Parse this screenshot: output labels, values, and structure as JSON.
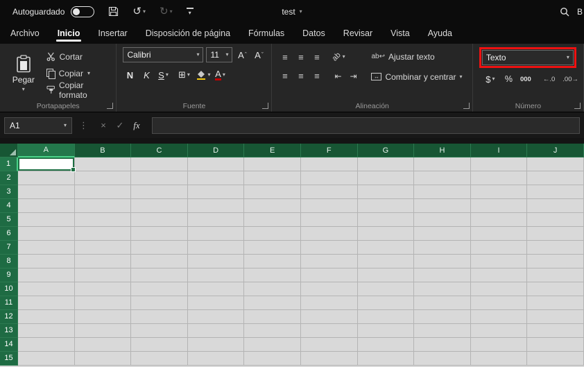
{
  "titlebar": {
    "autosave_label": "Autoguardado",
    "document_title": "test",
    "search_text": "B"
  },
  "tabs": [
    {
      "label": "Archivo",
      "active": false
    },
    {
      "label": "Inicio",
      "active": true
    },
    {
      "label": "Insertar",
      "active": false
    },
    {
      "label": "Disposición de página",
      "active": false
    },
    {
      "label": "Fórmulas",
      "active": false
    },
    {
      "label": "Datos",
      "active": false
    },
    {
      "label": "Revisar",
      "active": false
    },
    {
      "label": "Vista",
      "active": false
    },
    {
      "label": "Ayuda",
      "active": false
    }
  ],
  "ribbon": {
    "clipboard": {
      "group_label": "Portapapeles",
      "paste_label": "Pegar",
      "cut_label": "Cortar",
      "copy_label": "Copiar",
      "format_painter_label": "Copiar formato"
    },
    "font": {
      "group_label": "Fuente",
      "font_name": "Calibri",
      "font_size": "11",
      "bold_label": "N",
      "italic_label": "K",
      "underline_label": "S"
    },
    "alignment": {
      "group_label": "Alineación",
      "wrap_text_label": "Ajustar texto",
      "merge_center_label": "Combinar y centrar"
    },
    "number": {
      "group_label": "Número",
      "format_value": "Texto",
      "currency_label": "$",
      "percent_label": "%",
      "thousands_label": "000",
      "highlight_color": "#ee1111"
    }
  },
  "formula_bar": {
    "name_box_value": "A1",
    "fx_label": "fx",
    "formula_value": ""
  },
  "grid": {
    "columns": [
      "A",
      "B",
      "C",
      "D",
      "E",
      "F",
      "G",
      "H",
      "I",
      "J"
    ],
    "rows": [
      "1",
      "2",
      "3",
      "4",
      "5",
      "6",
      "7",
      "8",
      "9",
      "10",
      "11",
      "12",
      "13",
      "14",
      "15"
    ],
    "selected_column": "A",
    "selected_row": "1"
  },
  "colors": {
    "excel_green": "#1e6f43",
    "header_green": "#175634",
    "highlight_red": "#ee1111"
  },
  "icons": {
    "caret-down": "▾",
    "undo": "↺",
    "redo": "↻",
    "ellipsis-vertical": "⋮",
    "cancel": "×",
    "enter": "✓",
    "align-lines": "≡",
    "indent-decrease": "⇤",
    "indent-increase": "⇥",
    "borders": "⊞",
    "wrap-return": "↩",
    "merge-arrows": "↔",
    "grow-font-mark": "ˆ",
    "shrink-font-mark": "ˇ",
    "orientation-text": "ab",
    "wrap-text-mini": "ab",
    "letter-a": "A",
    "increase-decimal": "←.0",
    "decrease-decimal": ".00→"
  }
}
